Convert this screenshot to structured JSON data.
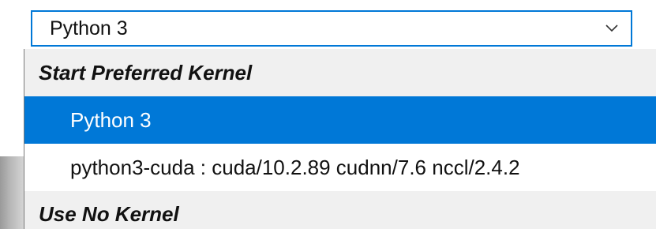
{
  "select": {
    "value": "Python 3",
    "icon": "chevron-down-icon"
  },
  "dropdown": {
    "group_start": "Start Preferred Kernel",
    "options": [
      {
        "label": "Python 3",
        "selected": true
      },
      {
        "label": "python3-cuda : cuda/10.2.89 cudnn/7.6 nccl/2.4.2",
        "selected": false
      }
    ],
    "group_none": "Use No Kernel"
  },
  "colors": {
    "accent": "#0078d7",
    "group_bg": "#f0f0f0",
    "selected_text": "#ffffff"
  }
}
